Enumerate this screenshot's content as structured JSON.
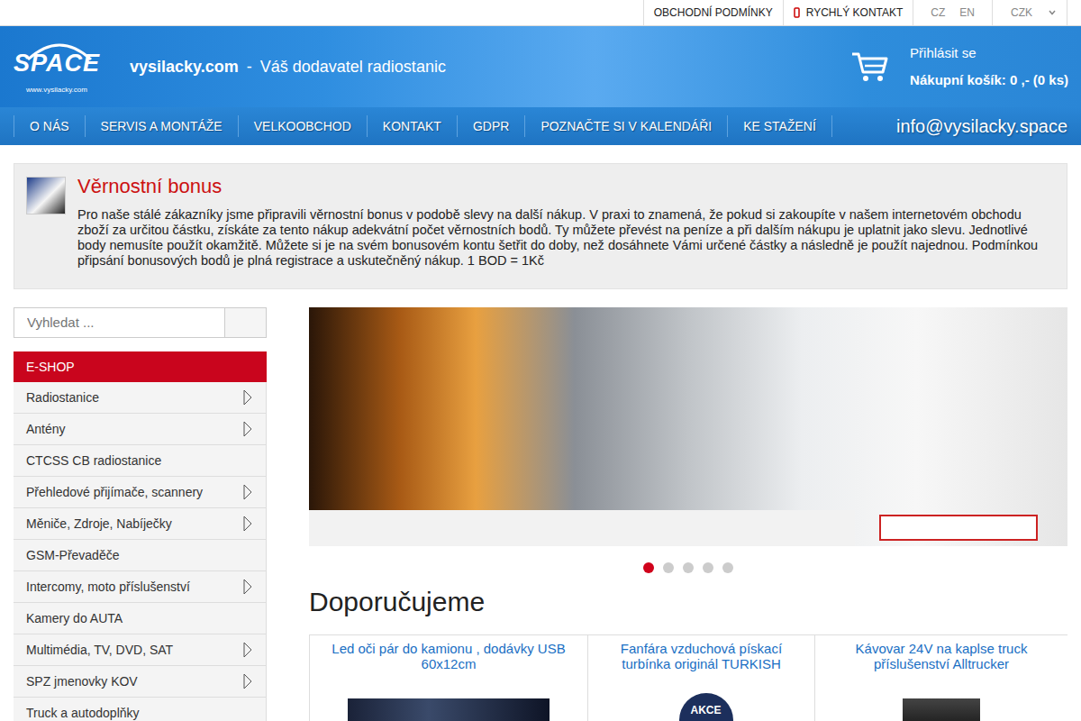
{
  "topbar": {
    "links": [
      "OBCHODNÍ PODMÍNKY",
      "RYCHLÝ KONTAKT"
    ],
    "languages": [
      "CZ",
      "EN"
    ],
    "currency": "CZK"
  },
  "header": {
    "logo": "SPACE",
    "logo_url": "www.vysilacky.com",
    "site": "vysilacky.com",
    "separator": "-",
    "tagline": "Váš dodavatel radiostanic",
    "login": "Přihlásit se",
    "cart": "Nákupní košík: 0 ,- (0 ks)"
  },
  "nav": {
    "items": [
      "O NÁS",
      "SERVIS A MONTÁŽE",
      "VELKOOBCHOD",
      "KONTAKT",
      "GDPR",
      "POZNAČTE SI V KALENDÁŘI",
      "KE STAŽENÍ"
    ],
    "email": "info@vysilacky.space"
  },
  "bonus": {
    "title": "Věrnostní bonus",
    "text": "Pro naše stálé zákazníky jsme připravili věrnostní bonus v podobě slevy na další nákup. V praxi to znamená, že pokud si zakoupíte v našem internetovém obchodu zboží za určitou částku, získáte za tento nákup adekvátní počet věrnostních bodů. Ty můžete převést na peníze a při dalším nákupu je uplatnit jako slevu. Jednotlivé body nemusíte použít okamžitě. Můžete si je na svém bonusovém kontu šetřit do doby, než dosáhnete Vámi určené částky a následně je použít najednou. Podmínkou připsání bonusových bodů je plná registrace a uskutečněný nákup. 1 BOD = 1Kč"
  },
  "search": {
    "placeholder": "Vyhledat ..."
  },
  "sidebar": {
    "heading": "E-SHOP",
    "items": [
      {
        "label": "Radiostanice",
        "has_submenu": true
      },
      {
        "label": "Antény",
        "has_submenu": true
      },
      {
        "label": "CTCSS CB radiostanice",
        "has_submenu": false
      },
      {
        "label": "Přehledové přijímače, scannery",
        "has_submenu": true
      },
      {
        "label": "Měniče, Zdroje, Nabíječky",
        "has_submenu": true
      },
      {
        "label": "GSM-Převaděče",
        "has_submenu": false
      },
      {
        "label": "Intercomy, moto příslušenství",
        "has_submenu": true
      },
      {
        "label": "Kamery do AUTA",
        "has_submenu": false
      },
      {
        "label": "Multimédia, TV, DVD, SAT",
        "has_submenu": true
      },
      {
        "label": "SPZ jmenovky KOV",
        "has_submenu": true
      },
      {
        "label": "Truck a autodoplňky",
        "has_submenu": false
      }
    ]
  },
  "slider": {
    "dots": [
      {
        "selected": true
      },
      {
        "selected": false
      },
      {
        "selected": false
      },
      {
        "selected": false
      },
      {
        "selected": false
      }
    ]
  },
  "recommended": {
    "title": "Doporučujeme",
    "products": [
      {
        "title": "Led oči pár do kamionu , dodávky USB 60x12cm",
        "badge": ""
      },
      {
        "title": "Fanfára vzduchová pískací turbínka originál TURKISH",
        "badge": "AKCE"
      },
      {
        "title": "Kávovar 24V na kaplse truck příslušenství Alltrucker",
        "badge": ""
      }
    ]
  }
}
